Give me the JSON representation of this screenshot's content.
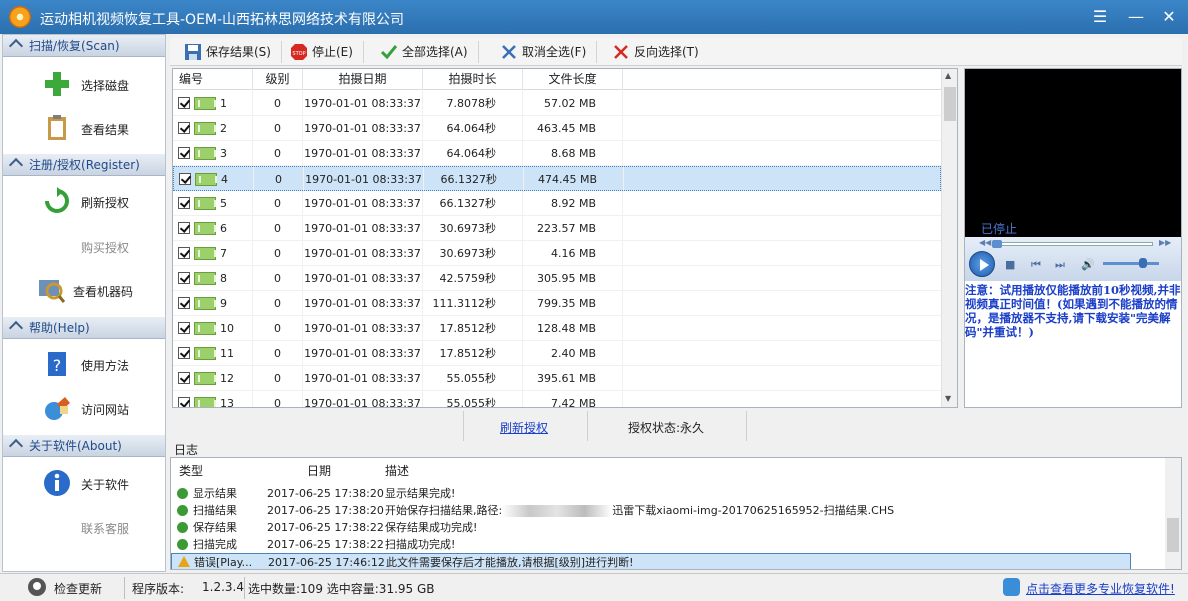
{
  "window": {
    "title": "运动相机视频恢复工具-OEM-山西拓林思网络技术有限公司"
  },
  "nav": {
    "sections": [
      {
        "title": "扫描/恢复(Scan)",
        "items": [
          "选择磁盘",
          "查看结果"
        ]
      },
      {
        "title": "注册/授权(Register)",
        "items": [
          "刷新授权",
          "购买授权",
          "查看机器码"
        ]
      },
      {
        "title": "帮助(Help)",
        "items": [
          "使用方法",
          "访问网站"
        ]
      },
      {
        "title": "关于软件(About)",
        "items": [
          "关于软件",
          "联系客服"
        ]
      }
    ]
  },
  "toolbar": {
    "save": "保存结果(S)",
    "stop": "停止(E)",
    "select_all": "全部选择(A)",
    "deselect_all": "取消全选(F)",
    "invert": "反向选择(T)"
  },
  "table": {
    "headers": [
      "编号",
      "级别",
      "拍摄日期",
      "拍摄时长",
      "文件长度"
    ],
    "rows": [
      {
        "id": "1",
        "level": "0",
        "date": "1970-01-01 08:33:37",
        "duration": "7.8078秒",
        "size": "57.02 MB"
      },
      {
        "id": "2",
        "level": "0",
        "date": "1970-01-01 08:33:37",
        "duration": "64.064秒",
        "size": "463.45 MB"
      },
      {
        "id": "3",
        "level": "0",
        "date": "1970-01-01 08:33:37",
        "duration": "64.064秒",
        "size": "8.68 MB"
      },
      {
        "id": "4",
        "level": "0",
        "date": "1970-01-01 08:33:37",
        "duration": "66.1327秒",
        "size": "474.45 MB"
      },
      {
        "id": "5",
        "level": "0",
        "date": "1970-01-01 08:33:37",
        "duration": "66.1327秒",
        "size": "8.92 MB"
      },
      {
        "id": "6",
        "level": "0",
        "date": "1970-01-01 08:33:37",
        "duration": "30.6973秒",
        "size": "223.57 MB"
      },
      {
        "id": "7",
        "level": "0",
        "date": "1970-01-01 08:33:37",
        "duration": "30.6973秒",
        "size": "4.16 MB"
      },
      {
        "id": "8",
        "level": "0",
        "date": "1970-01-01 08:33:37",
        "duration": "42.5759秒",
        "size": "305.95 MB"
      },
      {
        "id": "9",
        "level": "0",
        "date": "1970-01-01 08:33:37",
        "duration": "111.3112秒",
        "size": "799.35 MB"
      },
      {
        "id": "10",
        "level": "0",
        "date": "1970-01-01 08:33:37",
        "duration": "17.8512秒",
        "size": "128.48 MB"
      },
      {
        "id": "11",
        "level": "0",
        "date": "1970-01-01 08:33:37",
        "duration": "17.8512秒",
        "size": "2.40 MB"
      },
      {
        "id": "12",
        "level": "0",
        "date": "1970-01-01 08:33:37",
        "duration": "55.055秒",
        "size": "395.61 MB"
      },
      {
        "id": "13",
        "level": "0",
        "date": "1970-01-01 08:33:37",
        "duration": "55.055秒",
        "size": "7.42 MB"
      }
    ]
  },
  "player": {
    "state": "已停止",
    "notice": "注意：试用播放仅能播放前10秒视频,并非视频真正时间值！(如果遇到不能播放的情况，是播放器不支持,请下载安装\"完美解码\"并重试！)"
  },
  "license": {
    "refresh_link": "刷新授权",
    "status": "授权状态:永久"
  },
  "log": {
    "label": "日志",
    "headers": [
      "类型",
      "日期",
      "描述"
    ],
    "rows": [
      {
        "type": "显示结果",
        "date": "2017-06-25 17:38:20",
        "desc": "显示结果完成!",
        "kind": "ok"
      },
      {
        "type": "扫描结果",
        "date": "2017-06-25 17:38:20",
        "desc": "开始保存扫描结果,路径:",
        "desc2": "迅雷下载xiaomi-img-20170625165952-扫描结果.CHS",
        "kind": "ok"
      },
      {
        "type": "保存结果",
        "date": "2017-06-25 17:38:22",
        "desc": "保存结果成功完成!",
        "kind": "ok"
      },
      {
        "type": "扫描完成",
        "date": "2017-06-25 17:38:22",
        "desc": "扫描成功完成!",
        "kind": "ok"
      },
      {
        "type": "错误[Play...",
        "date": "2017-06-25 17:46:12",
        "desc": "此文件需要保存后才能播放,请根据[级别]进行判断!",
        "kind": "warn"
      }
    ]
  },
  "status": {
    "update": "检查更新",
    "version_label": "程序版本:",
    "version": "1.2.3.4",
    "selection": "选中数量:109 选中容量:31.95 GB",
    "promo": "点击查看更多专业恢复软件!"
  },
  "icons": [
    "menu-icon",
    "minimize-icon",
    "close-icon",
    "add-icon",
    "clipboard-icon",
    "refresh-icon",
    "scan-icon",
    "help-icon",
    "globe-icon",
    "info-icon",
    "save-icon",
    "stop-icon",
    "check-icon",
    "x-icon",
    "play-icon",
    "volume-icon"
  ],
  "colors": {
    "title_bar": "#2b6fae",
    "link": "#1a3ec8",
    "selection": "#cde3f7"
  }
}
